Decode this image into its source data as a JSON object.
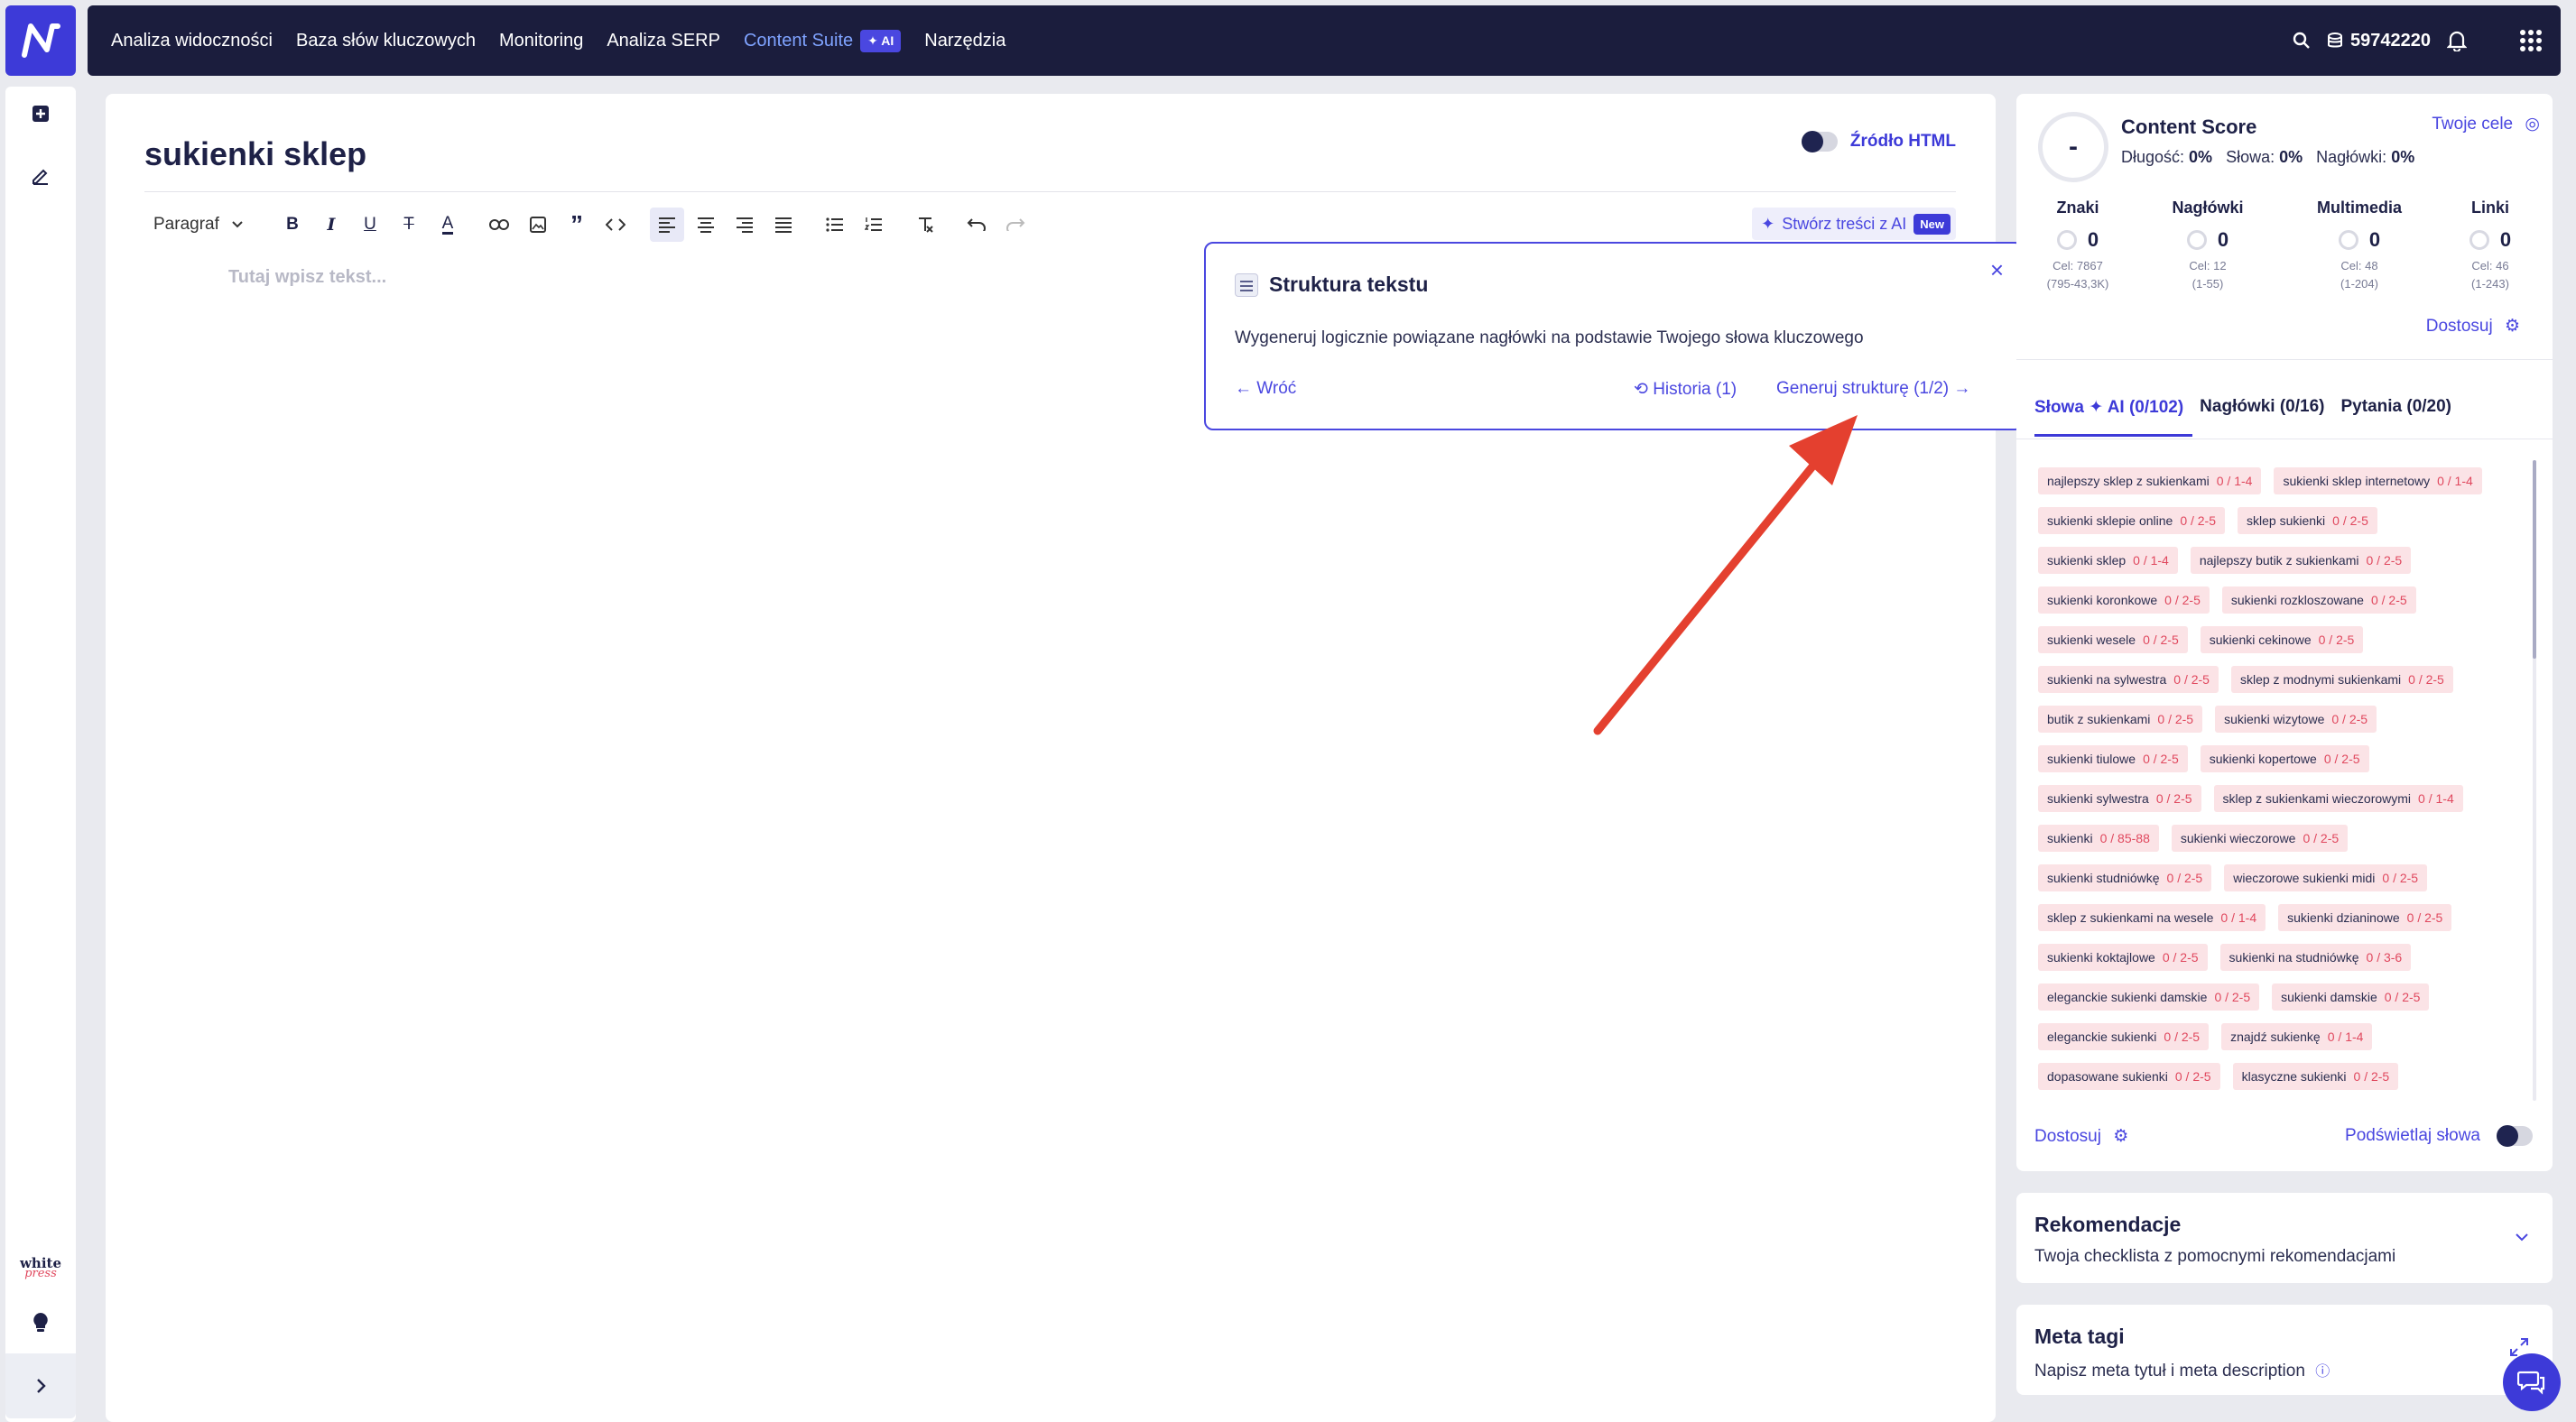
{
  "nav": {
    "items": [
      "Analiza widoczności",
      "Baza słów kluczowych",
      "Monitoring",
      "Analiza SERP",
      "Content Suite",
      "Narzędzia"
    ],
    "ai_badge": "AI",
    "credits": "59742220"
  },
  "sidebar": {
    "brand_line1": "white",
    "brand_line2": "press"
  },
  "editor": {
    "title": "sukienki sklep",
    "html_toggle_label": "Źródło HTML",
    "paragraph_select": "Paragraf",
    "ai_create_label": "Stwórz treści z AI",
    "new_badge": "New",
    "placeholder": "Tutaj wpisz tekst..."
  },
  "popover": {
    "title": "Struktura tekstu",
    "description": "Wygeneruj logicznie powiązane nagłówki na podstawie Twojego słowa kluczowego",
    "back": "← Wróć",
    "history": "Historia (1)",
    "generate": "Generuj strukturę (1/2) →"
  },
  "score": {
    "value": "-",
    "title": "Content Score",
    "goals_link": "Twoje cele",
    "length_label": "Długość:",
    "length_value": "0%",
    "words_label": "Słowa:",
    "words_value": "0%",
    "headings_label": "Nagłówki:",
    "headings_value": "0%",
    "metrics": [
      {
        "label": "Znaki",
        "value": "0",
        "target": "Cel: 7867",
        "range": "(795-43,3K)"
      },
      {
        "label": "Nagłówki",
        "value": "0",
        "target": "Cel: 12",
        "range": "(1-55)"
      },
      {
        "label": "Multimedia",
        "value": "0",
        "target": "Cel: 48",
        "range": "(1-204)"
      },
      {
        "label": "Linki",
        "value": "0",
        "target": "Cel: 46",
        "range": "(1-243)"
      }
    ],
    "adjust": "Dostosuj"
  },
  "tabs": [
    {
      "label": "Słowa",
      "ai": "AI",
      "count": "(0/102)"
    },
    {
      "label": "Nagłówki (0/16)"
    },
    {
      "label": "Pytania (0/20)"
    }
  ],
  "keywords": [
    {
      "text": "najlepszy sklep z sukienkami",
      "count": "0 / 1-4"
    },
    {
      "text": "sukienki sklep internetowy",
      "count": "0 / 1-4"
    },
    {
      "text": "sukienki sklepie online",
      "count": "0 / 2-5"
    },
    {
      "text": "sklep sukienki",
      "count": "0 / 2-5"
    },
    {
      "text": "sukienki sklep",
      "count": "0 / 1-4"
    },
    {
      "text": "najlepszy butik z sukienkami",
      "count": "0 / 2-5"
    },
    {
      "text": "sukienki koronkowe",
      "count": "0 / 2-5"
    },
    {
      "text": "sukienki rozkloszowane",
      "count": "0 / 2-5"
    },
    {
      "text": "sukienki wesele",
      "count": "0 / 2-5"
    },
    {
      "text": "sukienki cekinowe",
      "count": "0 / 2-5"
    },
    {
      "text": "sukienki na sylwestra",
      "count": "0 / 2-5"
    },
    {
      "text": "sklep z modnymi sukienkami",
      "count": "0 / 2-5"
    },
    {
      "text": "butik z sukienkami",
      "count": "0 / 2-5"
    },
    {
      "text": "sukienki wizytowe",
      "count": "0 / 2-5"
    },
    {
      "text": "sukienki tiulowe",
      "count": "0 / 2-5"
    },
    {
      "text": "sukienki kopertowe",
      "count": "0 / 2-5"
    },
    {
      "text": "sukienki sylwestra",
      "count": "0 / 2-5"
    },
    {
      "text": "sklep z sukienkami wieczorowymi",
      "count": "0 / 1-4"
    },
    {
      "text": "sukienki",
      "count": "0 / 85-88"
    },
    {
      "text": "sukienki wieczorowe",
      "count": "0 / 2-5"
    },
    {
      "text": "sukienki studniówkę",
      "count": "0 / 2-5"
    },
    {
      "text": "wieczorowe sukienki midi",
      "count": "0 / 2-5"
    },
    {
      "text": "sklep z sukienkami na wesele",
      "count": "0 / 1-4"
    },
    {
      "text": "sukienki dzianinowe",
      "count": "0 / 2-5"
    },
    {
      "text": "sukienki koktajlowe",
      "count": "0 / 2-5"
    },
    {
      "text": "sukienki na studniówkę",
      "count": "0 / 3-6"
    },
    {
      "text": "eleganckie sukienki damskie",
      "count": "0 / 2-5"
    },
    {
      "text": "sukienki damskie",
      "count": "0 / 2-5"
    },
    {
      "text": "eleganckie sukienki",
      "count": "0 / 2-5"
    },
    {
      "text": "znajdź sukienkę",
      "count": "0 / 1-4"
    },
    {
      "text": "dopasowane sukienki",
      "count": "0 / 2-5"
    },
    {
      "text": "klasyczne sukienki",
      "count": "0 / 2-5"
    }
  ],
  "keyword_footer": {
    "adjust": "Dostosuj",
    "highlight": "Podświetlaj słowa"
  },
  "recommendations": {
    "title": "Rekomendacje",
    "subtitle": "Twoja checklista z pomocnymi rekomendacjami"
  },
  "meta": {
    "title": "Meta tagi",
    "subtitle": "Napisz meta tytuł i meta description"
  },
  "colors": {
    "accent": "#3d3ad8",
    "nav_bg": "#1b1d3d",
    "keyword_bg": "#fbe3e6",
    "keyword_count": "#e0485e",
    "arrow": "#e4402f"
  }
}
